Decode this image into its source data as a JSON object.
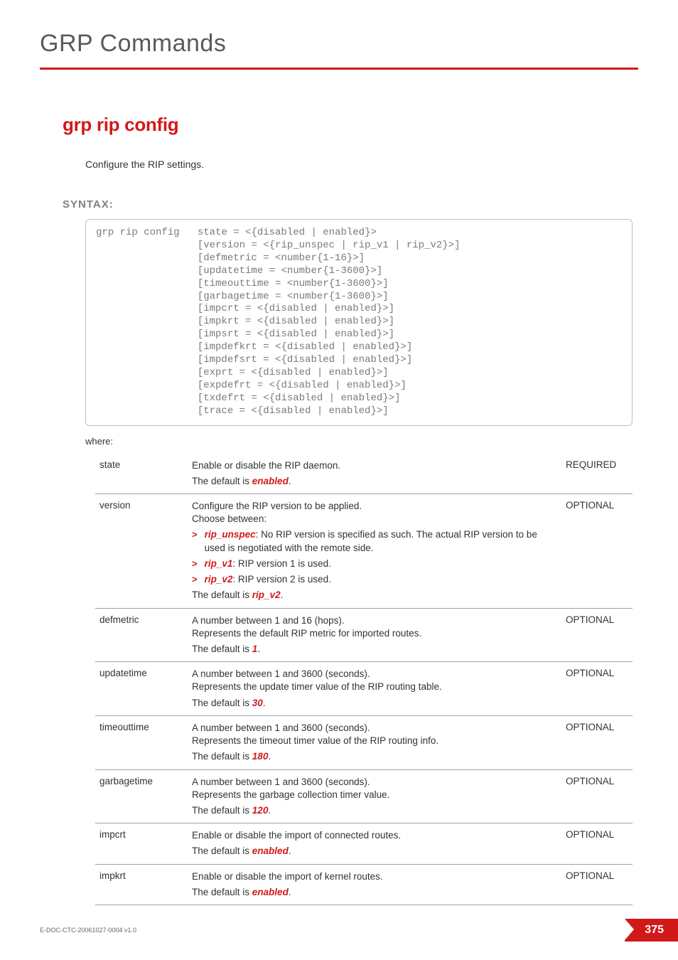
{
  "chapter": "GRP Commands",
  "section": "grp rip config",
  "intro": "Configure the RIP settings.",
  "syntax_label": "SYNTAX:",
  "syntax_cmd": "grp rip config",
  "syntax_args": "state = <{disabled | enabled}>\n[version = <{rip_unspec | rip_v1 | rip_v2}>]\n[defmetric = <number{1-16}>]\n[updatetime = <number{1-3600}>]\n[timeouttime = <number{1-3600}>]\n[garbagetime = <number{1-3600}>]\n[impcrt = <{disabled | enabled}>]\n[impkrt = <{disabled | enabled}>]\n[impsrt = <{disabled | enabled}>]\n[impdefkrt = <{disabled | enabled}>]\n[impdefsrt = <{disabled | enabled}>]\n[exprt = <{disabled | enabled}>]\n[expdefrt = <{disabled | enabled}>]\n[txdefrt = <{disabled | enabled}>]\n[trace = <{disabled | enabled}>]",
  "where": "where:",
  "params": [
    {
      "name": "state",
      "req": "REQUIRED",
      "pre": "Enable or disable the RIP daemon.",
      "default_prefix": "The default is ",
      "default_value": "enabled",
      "default_suffix": "."
    },
    {
      "name": "version",
      "req": "OPTIONAL",
      "pre": "Configure the RIP version to be applied.\nChoose between:",
      "bullets": [
        {
          "term": "rip_unspec",
          "text": ": No RIP version is specified as such. The actual RIP version to be used is negotiated with the remote side."
        },
        {
          "term": "rip_v1",
          "text": ": RIP version 1 is used."
        },
        {
          "term": "rip_v2",
          "text": ": RIP version 2 is used."
        }
      ],
      "default_prefix": "The default is ",
      "default_value": "rip_v2",
      "default_suffix": "."
    },
    {
      "name": "defmetric",
      "req": "OPTIONAL",
      "pre": "A number between 1 and 16 (hops).\nRepresents the default RIP metric for imported routes.",
      "default_prefix": "The default is ",
      "default_value": "1",
      "default_suffix": "."
    },
    {
      "name": "updatetime",
      "req": "OPTIONAL",
      "pre": "A number between 1 and 3600 (seconds).\nRepresents the update timer value of the RIP routing table.",
      "default_prefix": "The default is ",
      "default_value": "30",
      "default_suffix": "."
    },
    {
      "name": "timeouttime",
      "req": "OPTIONAL",
      "pre": "A number between 1 and 3600 (seconds).\nRepresents the timeout timer value of the RIP routing info.",
      "default_prefix": "The default is ",
      "default_value": "180",
      "default_suffix": "."
    },
    {
      "name": "garbagetime",
      "req": "OPTIONAL",
      "pre": "A number between 1 and 3600 (seconds).\nRepresents the garbage collection timer value.",
      "default_prefix": "The default is ",
      "default_value": "120",
      "default_suffix": "."
    },
    {
      "name": "impcrt",
      "req": "OPTIONAL",
      "pre": "Enable or disable the import of connected routes.",
      "default_prefix": "The default is ",
      "default_value": "enabled",
      "default_suffix": "."
    },
    {
      "name": "impkrt",
      "req": "OPTIONAL",
      "pre": "Enable or disable the import of kernel routes.",
      "default_prefix": "The default is ",
      "default_value": "enabled",
      "default_suffix": "."
    }
  ],
  "footer_docid": "E-DOC-CTC-20061027-0004 v1.0",
  "page_number": "375"
}
